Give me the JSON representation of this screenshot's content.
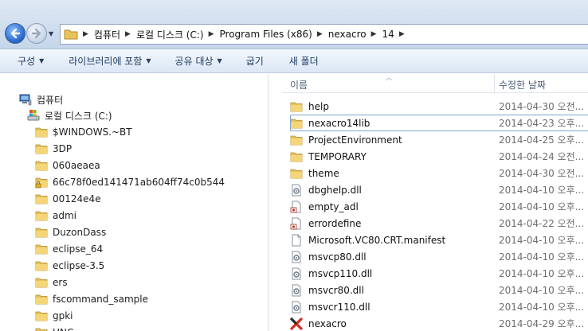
{
  "address": {
    "crumbs": [
      "컴퓨터",
      "로컬 디스크 (C:)",
      "Program Files (x86)",
      "nexacro",
      "14"
    ]
  },
  "toolbar": {
    "organize": "구성",
    "include_library": "라이브러리에 포함",
    "share_with": "공유 대상",
    "burn": "굽기",
    "new_folder": "새 폴더"
  },
  "nav": {
    "computer": "컴퓨터",
    "local_disk": "로컬 디스크 (C:)",
    "folders": [
      {
        "label": "$WINDOWS.~BT",
        "icon": "folder-icon"
      },
      {
        "label": "3DP",
        "icon": "folder-icon"
      },
      {
        "label": "060aeaea",
        "icon": "folder-icon"
      },
      {
        "label": "66c78f0ed141471ab604ff74c0b544",
        "icon": "locked-folder-icon"
      },
      {
        "label": "00124e4e",
        "icon": "folder-icon"
      },
      {
        "label": "admi",
        "icon": "folder-icon"
      },
      {
        "label": "DuzonDass",
        "icon": "folder-icon"
      },
      {
        "label": "eclipse_64",
        "icon": "folder-icon"
      },
      {
        "label": "eclipse-3.5",
        "icon": "folder-icon"
      },
      {
        "label": "ers",
        "icon": "folder-icon"
      },
      {
        "label": "fscommand_sample",
        "icon": "folder-icon"
      },
      {
        "label": "gpki",
        "icon": "folder-icon"
      },
      {
        "label": "HNC",
        "icon": "folder-icon"
      }
    ]
  },
  "filelist": {
    "col_name": "이름",
    "col_date": "수정한 날짜",
    "rows": [
      {
        "name": "help",
        "date": "2014-04-30 오전...",
        "icon": "folder-icon"
      },
      {
        "name": "nexacro14lib",
        "date": "2014-04-23 오후...",
        "icon": "folder-icon"
      },
      {
        "name": "ProjectEnvironment",
        "date": "2014-04-25 오후...",
        "icon": "folder-icon"
      },
      {
        "name": "TEMPORARY",
        "date": "2014-04-24 오전...",
        "icon": "folder-icon"
      },
      {
        "name": "theme",
        "date": "2014-04-30 오전...",
        "icon": "folder-icon"
      },
      {
        "name": "dbghelp.dll",
        "date": "2014-04-10 오후...",
        "icon": "dll-file-icon"
      },
      {
        "name": "empty_adl",
        "date": "2014-04-10 오후...",
        "icon": "generic-file-icon"
      },
      {
        "name": "errordefine",
        "date": "2014-04-22 오전...",
        "icon": "generic-file-icon"
      },
      {
        "name": "Microsoft.VC80.CRT.manifest",
        "date": "2014-04-10 오후...",
        "icon": "blank-file-icon"
      },
      {
        "name": "msvcp80.dll",
        "date": "2014-04-10 오후...",
        "icon": "dll-file-icon"
      },
      {
        "name": "msvcp110.dll",
        "date": "2014-04-10 오후...",
        "icon": "dll-file-icon"
      },
      {
        "name": "msvcr80.dll",
        "date": "2014-04-10 오후...",
        "icon": "dll-file-icon"
      },
      {
        "name": "msvcr110.dll",
        "date": "2014-04-10 오후...",
        "icon": "dll-file-icon"
      },
      {
        "name": "nexacro",
        "date": "2014-04-29 오후...",
        "icon": "nexacro-app-icon"
      }
    ]
  },
  "colors": {
    "folder": "#e8c25a",
    "focus_outline": "#7da2ce",
    "nexacro_red": "#d62b1f"
  }
}
